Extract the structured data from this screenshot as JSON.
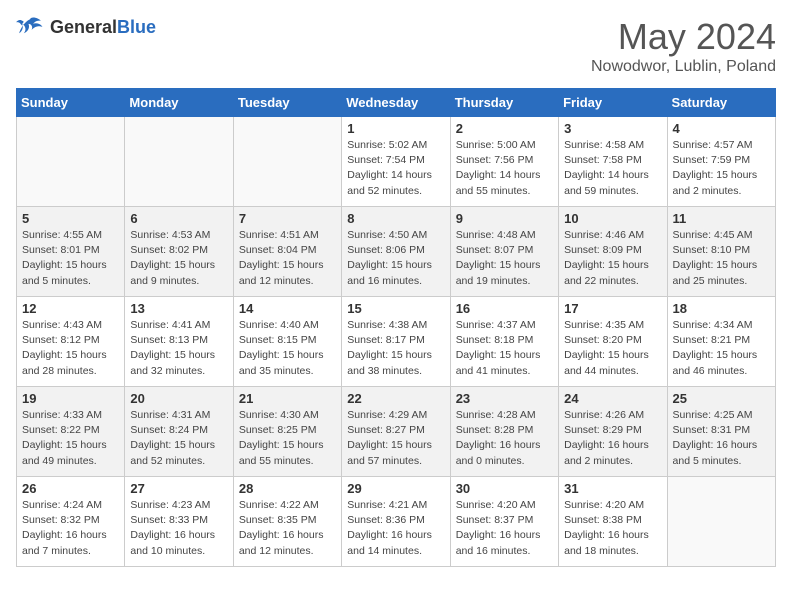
{
  "header": {
    "logo_general": "General",
    "logo_blue": "Blue",
    "month": "May 2024",
    "location": "Nowodwor, Lublin, Poland"
  },
  "days_of_week": [
    "Sunday",
    "Monday",
    "Tuesday",
    "Wednesday",
    "Thursday",
    "Friday",
    "Saturday"
  ],
  "weeks": [
    [
      {
        "day": "",
        "info": ""
      },
      {
        "day": "",
        "info": ""
      },
      {
        "day": "",
        "info": ""
      },
      {
        "day": "1",
        "info": "Sunrise: 5:02 AM\nSunset: 7:54 PM\nDaylight: 14 hours\nand 52 minutes."
      },
      {
        "day": "2",
        "info": "Sunrise: 5:00 AM\nSunset: 7:56 PM\nDaylight: 14 hours\nand 55 minutes."
      },
      {
        "day": "3",
        "info": "Sunrise: 4:58 AM\nSunset: 7:58 PM\nDaylight: 14 hours\nand 59 minutes."
      },
      {
        "day": "4",
        "info": "Sunrise: 4:57 AM\nSunset: 7:59 PM\nDaylight: 15 hours\nand 2 minutes."
      }
    ],
    [
      {
        "day": "5",
        "info": "Sunrise: 4:55 AM\nSunset: 8:01 PM\nDaylight: 15 hours\nand 5 minutes."
      },
      {
        "day": "6",
        "info": "Sunrise: 4:53 AM\nSunset: 8:02 PM\nDaylight: 15 hours\nand 9 minutes."
      },
      {
        "day": "7",
        "info": "Sunrise: 4:51 AM\nSunset: 8:04 PM\nDaylight: 15 hours\nand 12 minutes."
      },
      {
        "day": "8",
        "info": "Sunrise: 4:50 AM\nSunset: 8:06 PM\nDaylight: 15 hours\nand 16 minutes."
      },
      {
        "day": "9",
        "info": "Sunrise: 4:48 AM\nSunset: 8:07 PM\nDaylight: 15 hours\nand 19 minutes."
      },
      {
        "day": "10",
        "info": "Sunrise: 4:46 AM\nSunset: 8:09 PM\nDaylight: 15 hours\nand 22 minutes."
      },
      {
        "day": "11",
        "info": "Sunrise: 4:45 AM\nSunset: 8:10 PM\nDaylight: 15 hours\nand 25 minutes."
      }
    ],
    [
      {
        "day": "12",
        "info": "Sunrise: 4:43 AM\nSunset: 8:12 PM\nDaylight: 15 hours\nand 28 minutes."
      },
      {
        "day": "13",
        "info": "Sunrise: 4:41 AM\nSunset: 8:13 PM\nDaylight: 15 hours\nand 32 minutes."
      },
      {
        "day": "14",
        "info": "Sunrise: 4:40 AM\nSunset: 8:15 PM\nDaylight: 15 hours\nand 35 minutes."
      },
      {
        "day": "15",
        "info": "Sunrise: 4:38 AM\nSunset: 8:17 PM\nDaylight: 15 hours\nand 38 minutes."
      },
      {
        "day": "16",
        "info": "Sunrise: 4:37 AM\nSunset: 8:18 PM\nDaylight: 15 hours\nand 41 minutes."
      },
      {
        "day": "17",
        "info": "Sunrise: 4:35 AM\nSunset: 8:20 PM\nDaylight: 15 hours\nand 44 minutes."
      },
      {
        "day": "18",
        "info": "Sunrise: 4:34 AM\nSunset: 8:21 PM\nDaylight: 15 hours\nand 46 minutes."
      }
    ],
    [
      {
        "day": "19",
        "info": "Sunrise: 4:33 AM\nSunset: 8:22 PM\nDaylight: 15 hours\nand 49 minutes."
      },
      {
        "day": "20",
        "info": "Sunrise: 4:31 AM\nSunset: 8:24 PM\nDaylight: 15 hours\nand 52 minutes."
      },
      {
        "day": "21",
        "info": "Sunrise: 4:30 AM\nSunset: 8:25 PM\nDaylight: 15 hours\nand 55 minutes."
      },
      {
        "day": "22",
        "info": "Sunrise: 4:29 AM\nSunset: 8:27 PM\nDaylight: 15 hours\nand 57 minutes."
      },
      {
        "day": "23",
        "info": "Sunrise: 4:28 AM\nSunset: 8:28 PM\nDaylight: 16 hours\nand 0 minutes."
      },
      {
        "day": "24",
        "info": "Sunrise: 4:26 AM\nSunset: 8:29 PM\nDaylight: 16 hours\nand 2 minutes."
      },
      {
        "day": "25",
        "info": "Sunrise: 4:25 AM\nSunset: 8:31 PM\nDaylight: 16 hours\nand 5 minutes."
      }
    ],
    [
      {
        "day": "26",
        "info": "Sunrise: 4:24 AM\nSunset: 8:32 PM\nDaylight: 16 hours\nand 7 minutes."
      },
      {
        "day": "27",
        "info": "Sunrise: 4:23 AM\nSunset: 8:33 PM\nDaylight: 16 hours\nand 10 minutes."
      },
      {
        "day": "28",
        "info": "Sunrise: 4:22 AM\nSunset: 8:35 PM\nDaylight: 16 hours\nand 12 minutes."
      },
      {
        "day": "29",
        "info": "Sunrise: 4:21 AM\nSunset: 8:36 PM\nDaylight: 16 hours\nand 14 minutes."
      },
      {
        "day": "30",
        "info": "Sunrise: 4:20 AM\nSunset: 8:37 PM\nDaylight: 16 hours\nand 16 minutes."
      },
      {
        "day": "31",
        "info": "Sunrise: 4:20 AM\nSunset: 8:38 PM\nDaylight: 16 hours\nand 18 minutes."
      },
      {
        "day": "",
        "info": ""
      }
    ]
  ]
}
